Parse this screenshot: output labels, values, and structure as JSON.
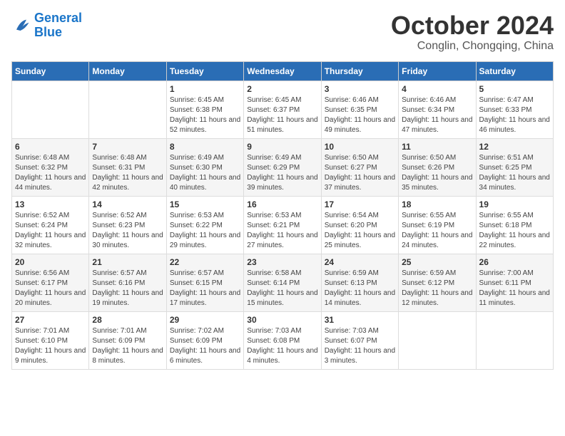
{
  "logo": {
    "line1": "General",
    "line2": "Blue"
  },
  "title": "October 2024",
  "subtitle": "Conglin, Chongqing, China",
  "days_of_week": [
    "Sunday",
    "Monday",
    "Tuesday",
    "Wednesday",
    "Thursday",
    "Friday",
    "Saturday"
  ],
  "weeks": [
    [
      {
        "day": "",
        "sunrise": "",
        "sunset": "",
        "daylight": ""
      },
      {
        "day": "",
        "sunrise": "",
        "sunset": "",
        "daylight": ""
      },
      {
        "day": "1",
        "sunrise": "Sunrise: 6:45 AM",
        "sunset": "Sunset: 6:38 PM",
        "daylight": "Daylight: 11 hours and 52 minutes."
      },
      {
        "day": "2",
        "sunrise": "Sunrise: 6:45 AM",
        "sunset": "Sunset: 6:37 PM",
        "daylight": "Daylight: 11 hours and 51 minutes."
      },
      {
        "day": "3",
        "sunrise": "Sunrise: 6:46 AM",
        "sunset": "Sunset: 6:35 PM",
        "daylight": "Daylight: 11 hours and 49 minutes."
      },
      {
        "day": "4",
        "sunrise": "Sunrise: 6:46 AM",
        "sunset": "Sunset: 6:34 PM",
        "daylight": "Daylight: 11 hours and 47 minutes."
      },
      {
        "day": "5",
        "sunrise": "Sunrise: 6:47 AM",
        "sunset": "Sunset: 6:33 PM",
        "daylight": "Daylight: 11 hours and 46 minutes."
      }
    ],
    [
      {
        "day": "6",
        "sunrise": "Sunrise: 6:48 AM",
        "sunset": "Sunset: 6:32 PM",
        "daylight": "Daylight: 11 hours and 44 minutes."
      },
      {
        "day": "7",
        "sunrise": "Sunrise: 6:48 AM",
        "sunset": "Sunset: 6:31 PM",
        "daylight": "Daylight: 11 hours and 42 minutes."
      },
      {
        "day": "8",
        "sunrise": "Sunrise: 6:49 AM",
        "sunset": "Sunset: 6:30 PM",
        "daylight": "Daylight: 11 hours and 40 minutes."
      },
      {
        "day": "9",
        "sunrise": "Sunrise: 6:49 AM",
        "sunset": "Sunset: 6:29 PM",
        "daylight": "Daylight: 11 hours and 39 minutes."
      },
      {
        "day": "10",
        "sunrise": "Sunrise: 6:50 AM",
        "sunset": "Sunset: 6:27 PM",
        "daylight": "Daylight: 11 hours and 37 minutes."
      },
      {
        "day": "11",
        "sunrise": "Sunrise: 6:50 AM",
        "sunset": "Sunset: 6:26 PM",
        "daylight": "Daylight: 11 hours and 35 minutes."
      },
      {
        "day": "12",
        "sunrise": "Sunrise: 6:51 AM",
        "sunset": "Sunset: 6:25 PM",
        "daylight": "Daylight: 11 hours and 34 minutes."
      }
    ],
    [
      {
        "day": "13",
        "sunrise": "Sunrise: 6:52 AM",
        "sunset": "Sunset: 6:24 PM",
        "daylight": "Daylight: 11 hours and 32 minutes."
      },
      {
        "day": "14",
        "sunrise": "Sunrise: 6:52 AM",
        "sunset": "Sunset: 6:23 PM",
        "daylight": "Daylight: 11 hours and 30 minutes."
      },
      {
        "day": "15",
        "sunrise": "Sunrise: 6:53 AM",
        "sunset": "Sunset: 6:22 PM",
        "daylight": "Daylight: 11 hours and 29 minutes."
      },
      {
        "day": "16",
        "sunrise": "Sunrise: 6:53 AM",
        "sunset": "Sunset: 6:21 PM",
        "daylight": "Daylight: 11 hours and 27 minutes."
      },
      {
        "day": "17",
        "sunrise": "Sunrise: 6:54 AM",
        "sunset": "Sunset: 6:20 PM",
        "daylight": "Daylight: 11 hours and 25 minutes."
      },
      {
        "day": "18",
        "sunrise": "Sunrise: 6:55 AM",
        "sunset": "Sunset: 6:19 PM",
        "daylight": "Daylight: 11 hours and 24 minutes."
      },
      {
        "day": "19",
        "sunrise": "Sunrise: 6:55 AM",
        "sunset": "Sunset: 6:18 PM",
        "daylight": "Daylight: 11 hours and 22 minutes."
      }
    ],
    [
      {
        "day": "20",
        "sunrise": "Sunrise: 6:56 AM",
        "sunset": "Sunset: 6:17 PM",
        "daylight": "Daylight: 11 hours and 20 minutes."
      },
      {
        "day": "21",
        "sunrise": "Sunrise: 6:57 AM",
        "sunset": "Sunset: 6:16 PM",
        "daylight": "Daylight: 11 hours and 19 minutes."
      },
      {
        "day": "22",
        "sunrise": "Sunrise: 6:57 AM",
        "sunset": "Sunset: 6:15 PM",
        "daylight": "Daylight: 11 hours and 17 minutes."
      },
      {
        "day": "23",
        "sunrise": "Sunrise: 6:58 AM",
        "sunset": "Sunset: 6:14 PM",
        "daylight": "Daylight: 11 hours and 15 minutes."
      },
      {
        "day": "24",
        "sunrise": "Sunrise: 6:59 AM",
        "sunset": "Sunset: 6:13 PM",
        "daylight": "Daylight: 11 hours and 14 minutes."
      },
      {
        "day": "25",
        "sunrise": "Sunrise: 6:59 AM",
        "sunset": "Sunset: 6:12 PM",
        "daylight": "Daylight: 11 hours and 12 minutes."
      },
      {
        "day": "26",
        "sunrise": "Sunrise: 7:00 AM",
        "sunset": "Sunset: 6:11 PM",
        "daylight": "Daylight: 11 hours and 11 minutes."
      }
    ],
    [
      {
        "day": "27",
        "sunrise": "Sunrise: 7:01 AM",
        "sunset": "Sunset: 6:10 PM",
        "daylight": "Daylight: 11 hours and 9 minutes."
      },
      {
        "day": "28",
        "sunrise": "Sunrise: 7:01 AM",
        "sunset": "Sunset: 6:09 PM",
        "daylight": "Daylight: 11 hours and 8 minutes."
      },
      {
        "day": "29",
        "sunrise": "Sunrise: 7:02 AM",
        "sunset": "Sunset: 6:09 PM",
        "daylight": "Daylight: 11 hours and 6 minutes."
      },
      {
        "day": "30",
        "sunrise": "Sunrise: 7:03 AM",
        "sunset": "Sunset: 6:08 PM",
        "daylight": "Daylight: 11 hours and 4 minutes."
      },
      {
        "day": "31",
        "sunrise": "Sunrise: 7:03 AM",
        "sunset": "Sunset: 6:07 PM",
        "daylight": "Daylight: 11 hours and 3 minutes."
      },
      {
        "day": "",
        "sunrise": "",
        "sunset": "",
        "daylight": ""
      },
      {
        "day": "",
        "sunrise": "",
        "sunset": "",
        "daylight": ""
      }
    ]
  ]
}
